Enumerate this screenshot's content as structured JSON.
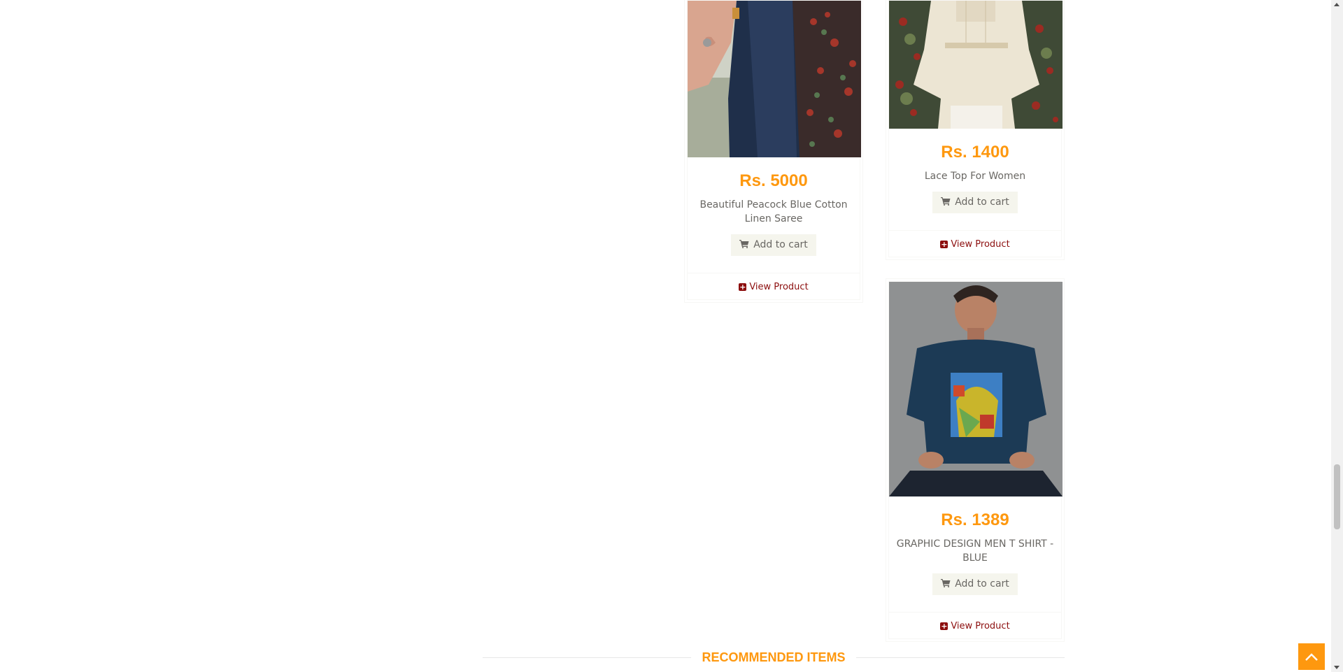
{
  "products": [
    {
      "price": "Rs. 5000",
      "name": "Beautiful Peacock Blue Cotton Linen Saree",
      "cart_label": "Add to cart",
      "view_label": "View Product"
    },
    {
      "price": "Rs. 1400",
      "name": "Lace Top For Women",
      "cart_label": "Add to cart",
      "view_label": "View Product"
    },
    {
      "price": "Rs. 1389",
      "name": "GRAPHIC DESIGN MEN T SHIRT - BLUE",
      "cart_label": "Add to cart",
      "view_label": "View Product"
    }
  ],
  "section": {
    "recommended_title": "RECOMMENDED ITEMS"
  },
  "colors": {
    "accent": "#FE980F",
    "link": "#8c0e0e",
    "button_bg": "#F5F5ED"
  },
  "icons": [
    "cart-icon",
    "plus-square-icon",
    "chevron-up-icon"
  ]
}
